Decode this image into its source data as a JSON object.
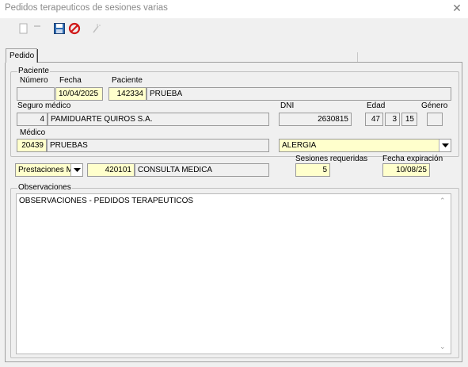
{
  "window": {
    "title": "Pedidos terapeuticos de sesiones varias"
  },
  "toolbar": {
    "icons": [
      "new-document-icon",
      "minus-icon",
      "save-icon",
      "cancel-icon",
      "sparkle-icon"
    ]
  },
  "tabs": [
    {
      "label": "Pedido",
      "active": true
    }
  ],
  "paciente": {
    "group_label": "Paciente",
    "numero_label": "Número",
    "numero_value": "",
    "fecha_label": "Fecha",
    "fecha_value": "10/04/2025",
    "paciente_label": "Paciente",
    "paciente_id": "142334",
    "paciente_name": "PRUEBA",
    "seguro_label": "Seguro médico",
    "seguro_id": "4",
    "seguro_name": "PAMIDUARTE QUIROS S.A.",
    "dni_label": "DNI",
    "dni_value": "2630815",
    "edad_label": "Edad",
    "edad_years": "47",
    "edad_months": "3",
    "edad_days": "15",
    "genero_label": "Género",
    "genero_value": "",
    "medico_label": "Médico",
    "medico_id": "20439",
    "medico_name": "PRUEBAS",
    "especialidad_value": "ALERGIA"
  },
  "prestacion": {
    "tipo_value": "Prestaciones M",
    "codigo": "420101",
    "descripcion": "CONSULTA MEDICA",
    "sesiones_label": "Sesiones requeridas",
    "sesiones_value": "5",
    "expiracion_label": "Fecha expiración",
    "expiracion_value": "10/08/25"
  },
  "observaciones": {
    "group_label": "Observaciones",
    "text": "OBSERVACIONES - PEDIDOS TERAPEUTICOS"
  },
  "colors": {
    "required_field": "#ffffcc",
    "window_bg": "#f0f0f0"
  }
}
